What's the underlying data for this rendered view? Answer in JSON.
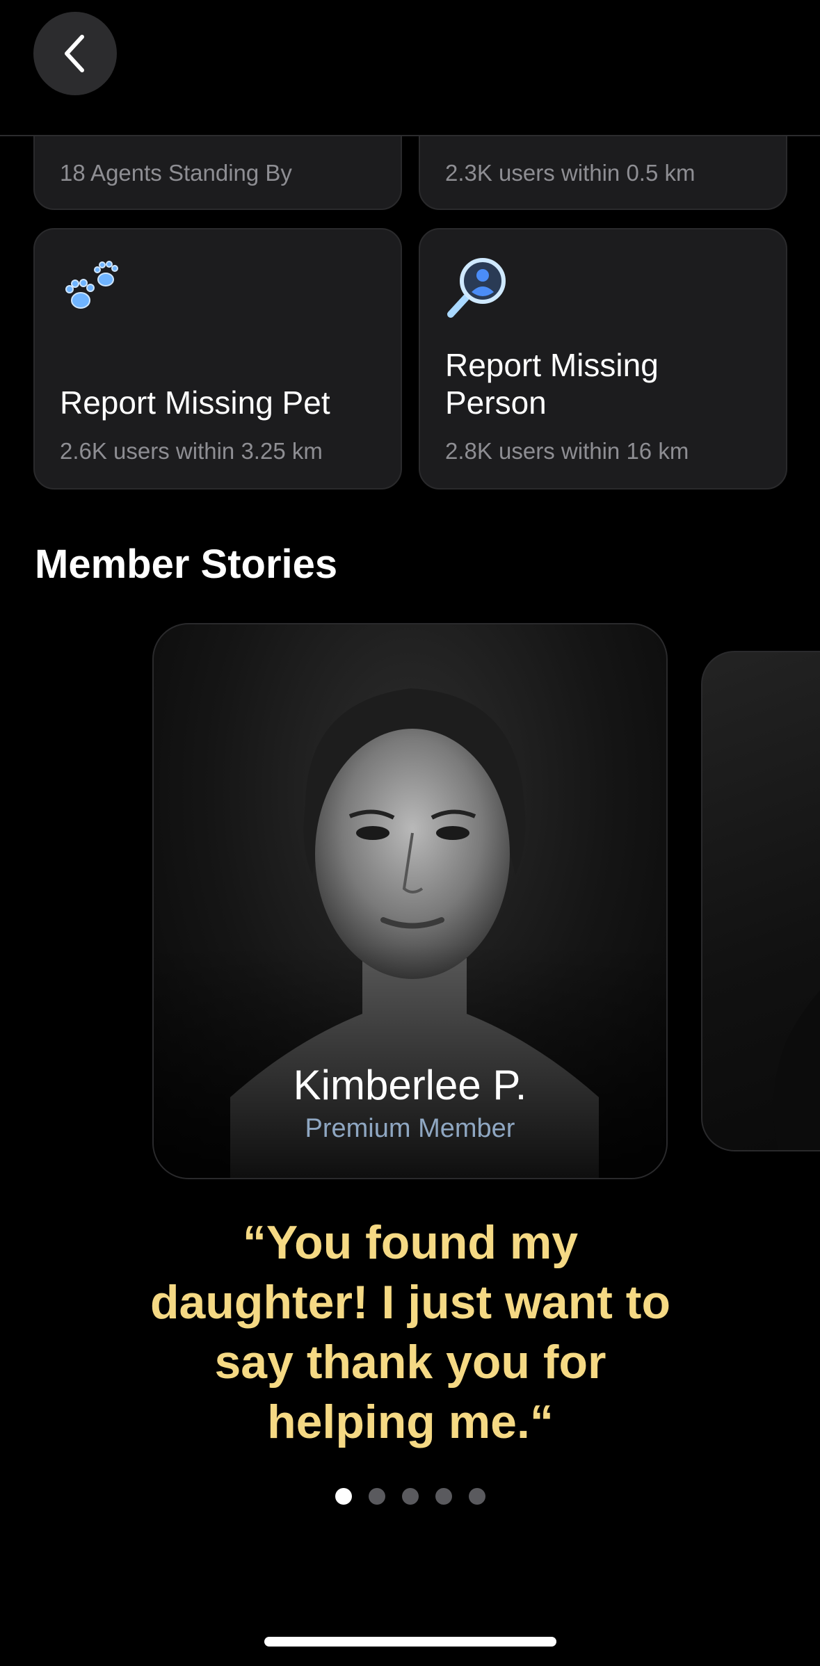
{
  "cards": [
    {
      "subtitle": "18 Agents Standing By"
    },
    {
      "subtitle": "2.3K users within 0.5 km"
    },
    {
      "title": "Report Missing Pet",
      "subtitle": "2.6K users within 3.25 km",
      "icon": "paw-icon"
    },
    {
      "title": "Report Missing Person",
      "subtitle": "2.8K users within 16 km",
      "icon": "magnifier-person-icon"
    }
  ],
  "section_title": "Member Stories",
  "story": {
    "name": "Kimberlee P.",
    "role": "Premium Member",
    "quote": "“You found my daughter! I just want to say thank you for helping me.“"
  },
  "pagination": {
    "total": 5,
    "active": 1
  },
  "colors": {
    "accent_quote": "#f5d984",
    "role": "#8fa7c2",
    "card": "#1c1c1e"
  }
}
